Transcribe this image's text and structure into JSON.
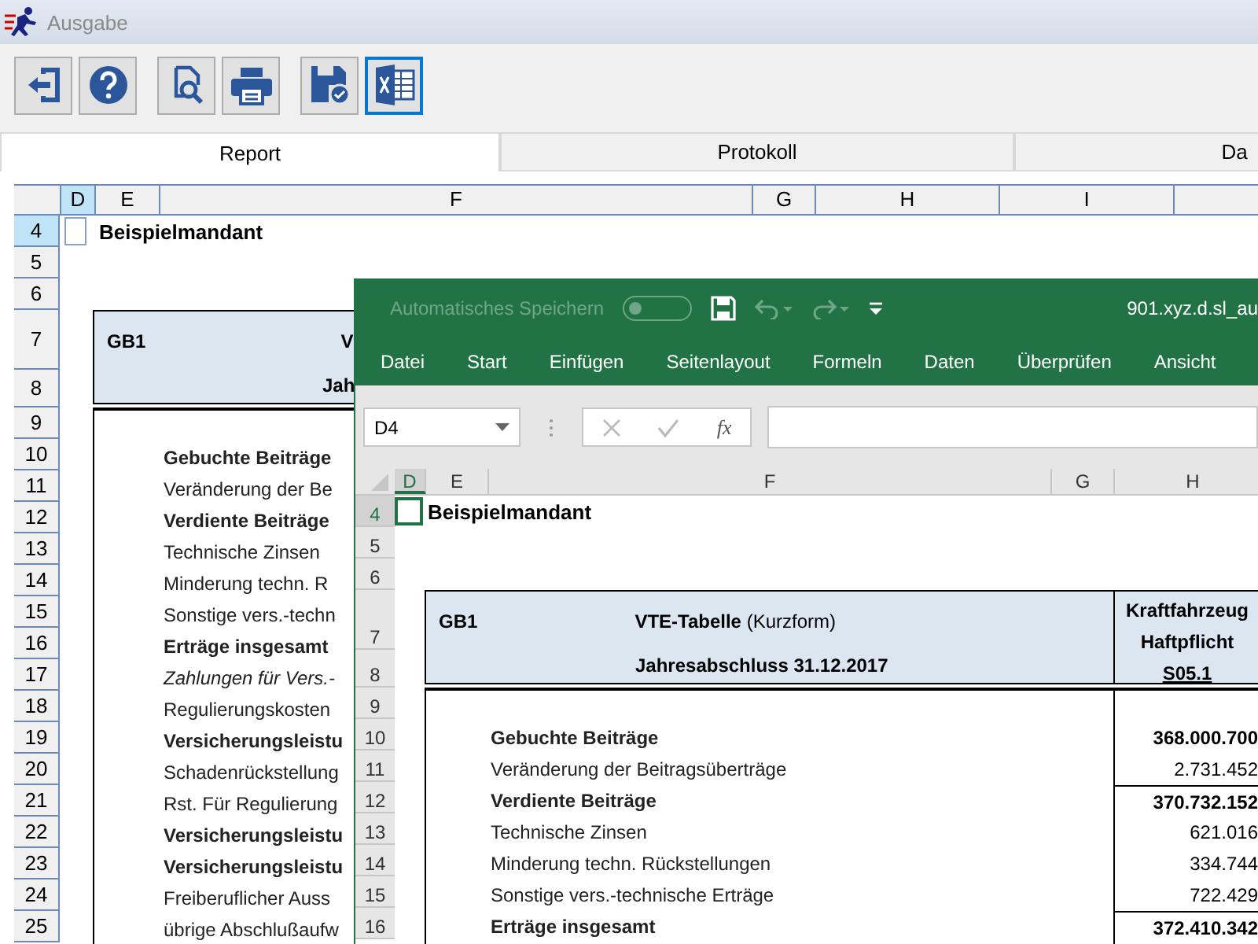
{
  "window": {
    "title": "Ausgabe"
  },
  "toolbar": [
    {
      "kind": "exit",
      "selected": false
    },
    {
      "kind": "help",
      "selected": false
    },
    {
      "kind": "preview",
      "selected": false
    },
    {
      "kind": "print",
      "selected": false
    },
    {
      "kind": "save",
      "selected": false
    },
    {
      "kind": "excel",
      "selected": true
    }
  ],
  "tabs": [
    {
      "label": "Report",
      "selected": true
    },
    {
      "label": "Protokoll",
      "selected": false
    },
    {
      "label": "Da",
      "selected": false
    }
  ],
  "sheet": {
    "columns": [
      {
        "label": "D",
        "selected": true
      },
      {
        "label": "E",
        "selected": false
      },
      {
        "label": "F",
        "selected": false
      },
      {
        "label": "G",
        "selected": false
      },
      {
        "label": "H",
        "selected": false
      },
      {
        "label": "I",
        "selected": false
      }
    ],
    "rows": [
      {
        "label": "4",
        "selected": true
      },
      {
        "label": "5",
        "selected": false
      },
      {
        "label": "6",
        "selected": false
      },
      {
        "label": "7",
        "selected": false
      },
      {
        "label": "8",
        "selected": false
      },
      {
        "label": "9",
        "selected": false
      },
      {
        "label": "10",
        "selected": false
      },
      {
        "label": "11",
        "selected": false
      },
      {
        "label": "12",
        "selected": false
      },
      {
        "label": "13",
        "selected": false
      },
      {
        "label": "14",
        "selected": false
      },
      {
        "label": "15",
        "selected": false
      },
      {
        "label": "16",
        "selected": false
      },
      {
        "label": "17",
        "selected": false
      },
      {
        "label": "18",
        "selected": false
      },
      {
        "label": "19",
        "selected": false
      },
      {
        "label": "20",
        "selected": false
      },
      {
        "label": "21",
        "selected": false
      },
      {
        "label": "22",
        "selected": false
      },
      {
        "label": "23",
        "selected": false
      },
      {
        "label": "24",
        "selected": false
      },
      {
        "label": "25",
        "selected": false
      }
    ],
    "company": "Beispielmandant",
    "header": {
      "code": "GB1",
      "title": "V",
      "subtitle": "Jah"
    },
    "lines": [
      {
        "text": "Gebuchte Beiträge",
        "kind": "bold"
      },
      {
        "text": "Veränderung der Be",
        "kind": "plain"
      },
      {
        "text": "Verdiente Beiträge",
        "kind": "bold"
      },
      {
        "text": "Technische Zinsen",
        "kind": "plain"
      },
      {
        "text": "Minderung techn. R",
        "kind": "plain"
      },
      {
        "text": "Sonstige vers.-techn",
        "kind": "plain"
      },
      {
        "text": "Erträge insgesamt",
        "kind": "bold"
      },
      {
        "text": "Zahlungen für Vers.-",
        "kind": "italic"
      },
      {
        "text": "Regulierungskosten",
        "kind": "plain"
      },
      {
        "text": "Versicherungsleistu",
        "kind": "bold"
      },
      {
        "text": "Schadenrückstellung",
        "kind": "plain"
      },
      {
        "text": "Rst. Für Regulierung",
        "kind": "plain"
      },
      {
        "text": "Versicherungsleistu",
        "kind": "bold"
      },
      {
        "text": "Versicherungsleistu",
        "kind": "bold"
      },
      {
        "text": "Freiberuflicher Auss",
        "kind": "plain"
      },
      {
        "text": "übrige Abschlußaufw",
        "kind": "plain"
      }
    ]
  },
  "excel": {
    "autosave": {
      "label": "Automatisches Speichern",
      "on": false
    },
    "filename": "901.xyz.d.sl_au",
    "ribbon_tabs": [
      "Datei",
      "Start",
      "Einfügen",
      "Seitenlayout",
      "Formeln",
      "Daten",
      "Überprüfen",
      "Ansicht"
    ],
    "name_box": "D4",
    "fx": "fx",
    "columns": [
      {
        "label": "D",
        "selected": true
      },
      {
        "label": "E",
        "selected": false
      },
      {
        "label": "F",
        "selected": false
      },
      {
        "label": "G",
        "selected": false
      },
      {
        "label": "H",
        "selected": false
      }
    ],
    "rows": [
      {
        "label": "4",
        "selected": true
      },
      {
        "label": "5",
        "selected": false
      },
      {
        "label": "6",
        "selected": false
      },
      {
        "label": "7",
        "selected": false
      },
      {
        "label": "8",
        "selected": false
      },
      {
        "label": "9",
        "selected": false
      },
      {
        "label": "10",
        "selected": false
      },
      {
        "label": "11",
        "selected": false
      },
      {
        "label": "12",
        "selected": false
      },
      {
        "label": "13",
        "selected": false
      },
      {
        "label": "14",
        "selected": false
      },
      {
        "label": "15",
        "selected": false
      },
      {
        "label": "16",
        "selected": false
      }
    ],
    "company": "Beispielmandant",
    "header": {
      "code": "GB1",
      "title": "**VTE-Tabelle** (Kurzform)",
      "subtitle": "Jahresabschluss 31.12.2017",
      "column_title": [
        "Kraftfahrzeug",
        "Haftpflicht"
      ],
      "column_code": "S05.1"
    },
    "lines": [
      {
        "text": "Gebuchte Beiträge",
        "kind": "bold",
        "value": "368.000.700",
        "total": false
      },
      {
        "text": "Veränderung der Beitragsüberträge",
        "kind": "plain",
        "value": "2.731.452",
        "total": false
      },
      {
        "text": "Verdiente Beiträge",
        "kind": "bold",
        "value": "370.732.152",
        "total": true
      },
      {
        "text": "Technische Zinsen",
        "kind": "plain",
        "value": "621.016",
        "total": false
      },
      {
        "text": "Minderung techn. Rückstellungen",
        "kind": "plain",
        "value": "334.744",
        "total": false
      },
      {
        "text": "Sonstige vers.-technische Erträge",
        "kind": "plain",
        "value": "722.429",
        "total": false
      },
      {
        "text": "Erträge insgesamt",
        "kind": "bold",
        "value": "372.410.342",
        "total": true
      }
    ]
  }
}
